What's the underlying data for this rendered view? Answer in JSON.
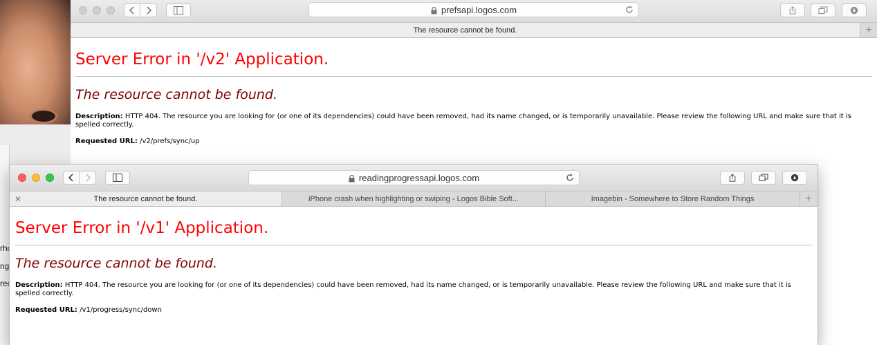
{
  "desktop": {
    "fragments": [
      "rho",
      "ng",
      "rec"
    ]
  },
  "back_window": {
    "url": "prefsapi.logos.com",
    "tabs": [
      {
        "label": "The resource cannot be found.",
        "active": true
      }
    ],
    "page": {
      "heading": "Server Error in '/v2' Application.",
      "subheading": "The resource cannot be found.",
      "description_label": "Description:",
      "description_text": "HTTP 404. The resource you are looking for (or one of its dependencies) could have been removed, had its name changed, or is temporarily unavailable.  Please review the following URL and make sure that it is spelled correctly.",
      "requested_url_label": "Requested URL:",
      "requested_url": "/v2/prefs/sync/up"
    }
  },
  "front_window": {
    "url": "readingprogressapi.logos.com",
    "tabs": [
      {
        "label": "The resource cannot be found.",
        "active": true
      },
      {
        "label": "iPhone crash when highlighting or swiping - Logos Bible Soft...",
        "active": false
      },
      {
        "label": "Imagebin - Somewhere to Store Random Things",
        "active": false
      }
    ],
    "page": {
      "heading": "Server Error in '/v1' Application.",
      "subheading": "The resource cannot be found.",
      "description_label": "Description:",
      "description_text": "HTTP 404. The resource you are looking for (or one of its dependencies) could have been removed, had its name changed, or is temporarily unavailable.  Please review the following URL and make sure that it is spelled correctly.",
      "requested_url_label": "Requested URL:",
      "requested_url": "/v1/progress/sync/down"
    }
  },
  "colors": {
    "error_heading": "#ff0000",
    "error_subheading": "#800000",
    "close_light": "#fc605c",
    "minimize_light": "#fdbc40",
    "zoom_light": "#34c84a"
  }
}
